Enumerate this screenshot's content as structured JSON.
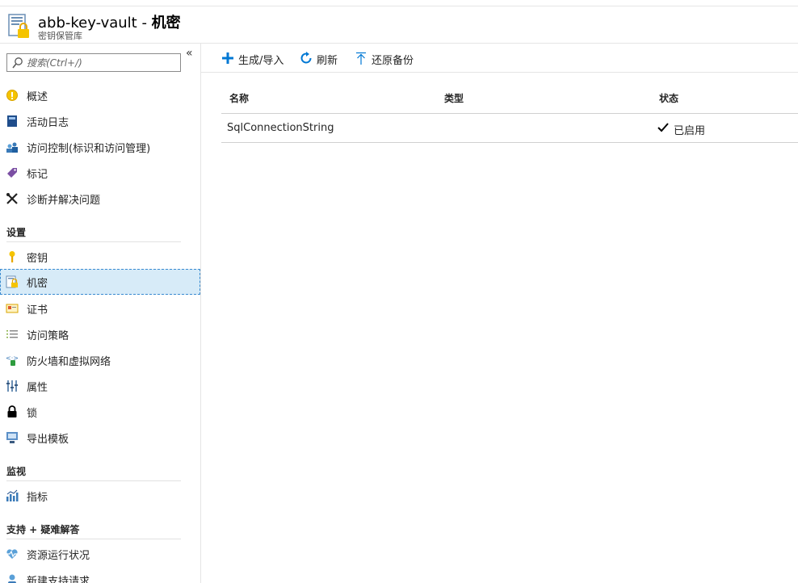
{
  "header": {
    "title_name": "abb-key-vault - ",
    "title_section": "机密",
    "subtitle": "密钥保管库"
  },
  "sidebar": {
    "collapse_label": "«",
    "search_placeholder": "搜索(Ctrl+/)",
    "items": [
      {
        "label": "概述",
        "icon": "overview-icon"
      },
      {
        "label": "活动日志",
        "icon": "activity-log-icon"
      },
      {
        "label": "访问控制(标识和访问管理)",
        "icon": "access-control-icon"
      },
      {
        "label": "标记",
        "icon": "tag-icon"
      },
      {
        "label": "诊断并解决问题",
        "icon": "wrench-icon"
      }
    ],
    "section_settings": "设置",
    "settings_items": [
      {
        "label": "密钥",
        "icon": "key-icon"
      },
      {
        "label": "机密",
        "icon": "secret-icon"
      },
      {
        "label": "证书",
        "icon": "certificate-icon"
      },
      {
        "label": "访问策略",
        "icon": "policy-list-icon"
      },
      {
        "label": "防火墙和虚拟网络",
        "icon": "network-icon"
      },
      {
        "label": "属性",
        "icon": "properties-icon"
      },
      {
        "label": "锁",
        "icon": "lock-icon"
      },
      {
        "label": "导出模板",
        "icon": "export-template-icon"
      }
    ],
    "section_monitoring": "监视",
    "monitoring_items": [
      {
        "label": "指标",
        "icon": "metrics-icon"
      }
    ],
    "section_support": "支持 + 疑难解答",
    "support_items": [
      {
        "label": "资源运行状况",
        "icon": "heart-icon"
      },
      {
        "label": "新建支持请求",
        "icon": "support-person-icon"
      }
    ]
  },
  "toolbar": {
    "generate_label": "生成/导入",
    "refresh_label": "刷新",
    "restore_label": "还原备份"
  },
  "table": {
    "columns": [
      "名称",
      "类型",
      "状态"
    ],
    "rows": [
      {
        "name": "SqlConnectionString",
        "type": "",
        "status": "已启用"
      }
    ]
  },
  "colors": {
    "accent": "#0078d4",
    "active_bg": "#d7ebf8",
    "key_yellow": "#f5c400"
  }
}
